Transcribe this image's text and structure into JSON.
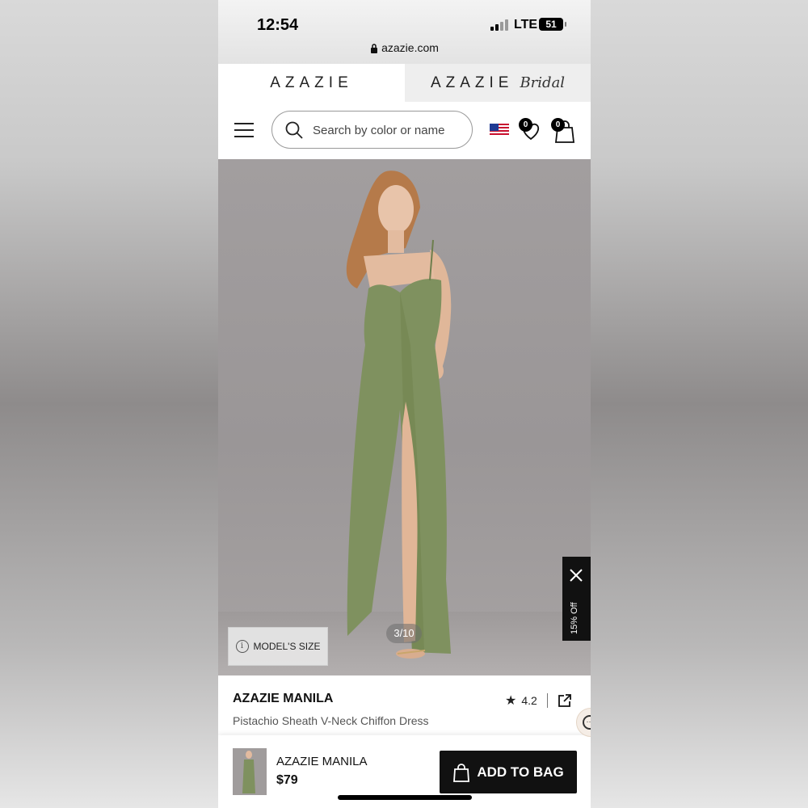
{
  "status_bar": {
    "time": "12:54",
    "network": "LTE",
    "battery": "51",
    "url": "azazie.com"
  },
  "brand_tabs": {
    "main": "AZAZIE",
    "bridal_brand": "AZAZIE",
    "bridal_script": "Bridal"
  },
  "header": {
    "search_placeholder": "Search by color or name",
    "favorites_count": "0",
    "bag_count": "0",
    "icons": [
      "menu-icon",
      "search-icon",
      "us-flag-icon",
      "heart-icon",
      "shopping-bag-icon"
    ]
  },
  "hero": {
    "model_size_label": "MODEL'S SIZE",
    "image_counter": "3/10",
    "promo_text": "15% Off",
    "dress_color": "#7f915f"
  },
  "product": {
    "name": "AZAZIE MANILA",
    "subtitle": "Pistachio Sheath V-Neck Chiffon Dress",
    "rating": "4.2"
  },
  "bottom_bar": {
    "name": "AZAZIE MANILA",
    "price": "$79",
    "add_to_bag_label": "ADD TO BAG"
  },
  "colors": {
    "accent": "#111111",
    "hero_bg": "#9d999a"
  }
}
